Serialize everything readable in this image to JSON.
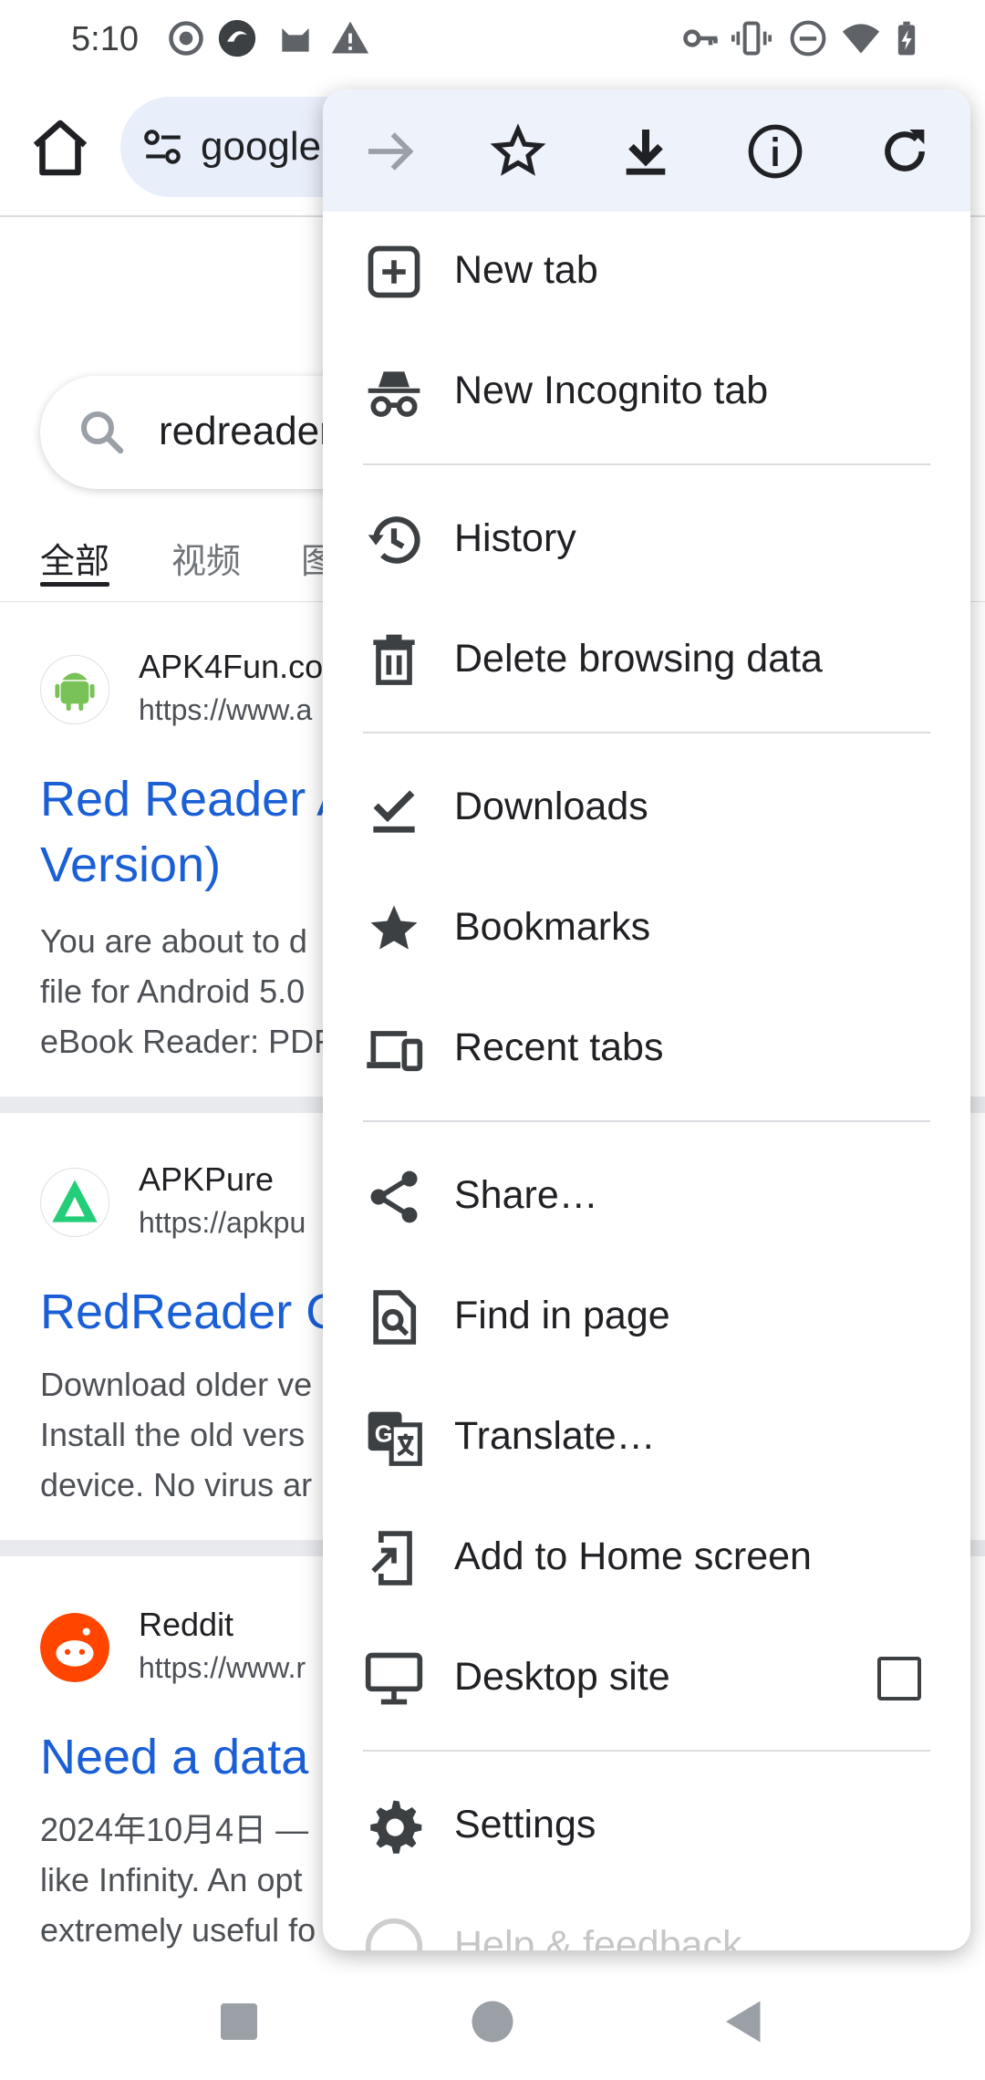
{
  "status_bar": {
    "time": "5:10",
    "left_icons": [
      "record-icon",
      "vpn-icon",
      "cat-icon",
      "warning-icon"
    ],
    "right_icons": [
      "key-icon",
      "vibrate-icon",
      "dnd-icon",
      "wifi-icon",
      "battery-icon"
    ]
  },
  "toolbar": {
    "url_text": "google"
  },
  "page": {
    "search_query": "redreader",
    "tabs": [
      "全部",
      "视频",
      "图"
    ],
    "results": [
      {
        "site": "APK4Fun.co",
        "url": "https://www.a",
        "title": "Red Reader A\nVersion)",
        "snippet": "You are about to d\nfile for Android 5.0\neBook Reader: PDF"
      },
      {
        "site": "APKPure",
        "url": "https://apkpu",
        "title": "RedReader C",
        "snippet": "Download older ve\nInstall the old vers\ndevice. No virus ar"
      },
      {
        "site": "Reddit",
        "url": "https://www.r",
        "title": "Need a data",
        "snippet": "2024年10月4日 —\nlike Infinity. An opt\nextremely useful fo"
      }
    ]
  },
  "menu": {
    "top_icons": [
      "forward-icon",
      "bookmark-star-icon",
      "download-icon",
      "info-icon",
      "reload-icon"
    ],
    "items": [
      {
        "label": "New tab",
        "icon": "new-tab-icon"
      },
      {
        "label": "New Incognito tab",
        "icon": "incognito-icon"
      },
      {
        "label": "History",
        "icon": "history-icon"
      },
      {
        "label": "Delete browsing data",
        "icon": "trash-icon"
      },
      {
        "label": "Downloads",
        "icon": "downloads-check-icon"
      },
      {
        "label": "Bookmarks",
        "icon": "star-icon"
      },
      {
        "label": "Recent tabs",
        "icon": "devices-icon"
      },
      {
        "label": "Share…",
        "icon": "share-icon"
      },
      {
        "label": "Find in page",
        "icon": "find-in-page-icon"
      },
      {
        "label": "Translate…",
        "icon": "translate-icon"
      },
      {
        "label": "Add to Home screen",
        "icon": "add-to-home-icon"
      },
      {
        "label": "Desktop site",
        "icon": "desktop-icon",
        "checked": false
      },
      {
        "label": "Settings",
        "icon": "settings-icon"
      },
      {
        "label": "Help & feedback",
        "icon": "help-icon"
      }
    ]
  },
  "colors": {
    "link": "#1a5fd6",
    "menu_top_bg": "#eef2fa",
    "omnibox_bg": "#e8eefa"
  }
}
